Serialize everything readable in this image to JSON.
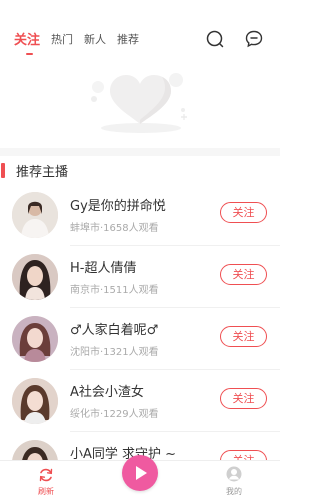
{
  "topnav": {
    "tabs": [
      {
        "label": "关注",
        "active": true
      },
      {
        "label": "热门",
        "active": false
      },
      {
        "label": "新人",
        "active": false
      },
      {
        "label": "推荐",
        "active": false
      }
    ],
    "icons": [
      "search-icon",
      "chat-icon"
    ],
    "accent_color": "#ef4f52"
  },
  "section": {
    "title": "推荐主播"
  },
  "streamers": [
    {
      "name": "Gy是你的拼命悦",
      "meta": "蚌埠市·1658人观看",
      "follow_label": "关注"
    },
    {
      "name": "H-超人倩倩",
      "meta": "南京市·1511人观看",
      "follow_label": "关注"
    },
    {
      "name": "♂人家白着呢♂",
      "meta": "沈阳市·1321人观看",
      "follow_label": "关注"
    },
    {
      "name": "A社会小渣女",
      "meta": "绥化市·1229人观看",
      "follow_label": "关注"
    },
    {
      "name": "小A同学  求守护 ~",
      "meta": "",
      "follow_label": "关注"
    }
  ],
  "bottombar": {
    "left": {
      "label": "刷新",
      "icon": "refresh-icon",
      "color": "#ef4f52"
    },
    "center": {
      "icon": "play-icon",
      "color": "#ef5aa0"
    },
    "right": {
      "label": "我的",
      "icon": "profile-icon",
      "color": "#999999"
    }
  }
}
